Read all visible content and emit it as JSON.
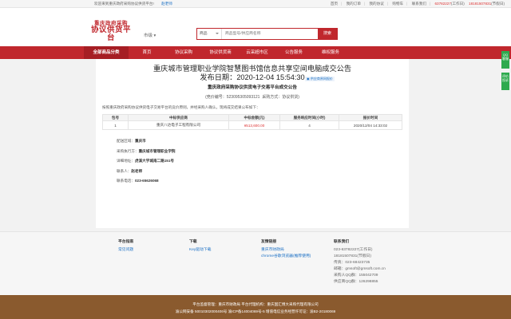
{
  "topbar": {
    "welcome": "欢迎来到重庆政府采购协议供货平台!",
    "user": "赵老师",
    "links": [
      "首页",
      "我的订单",
      "我的协议",
      "购物车",
      "联系我们"
    ],
    "phone1": "63782227",
    "phone1_note": "(工作日)",
    "phone2": "18181507831",
    "phone2_note": "(节假日)"
  },
  "header": {
    "logo_line1": "重庆政府采购",
    "logo_line2": "协议供货平台",
    "region": "市级",
    "search_category": "商品",
    "search_placeholder": "商品型号/供应商名称",
    "search_button": "搜索"
  },
  "nav": {
    "items": [
      "全部商品分类",
      "首页",
      "协议采购",
      "协议供货商",
      "云采超市区",
      "公告服务",
      "维权服务"
    ]
  },
  "side": {
    "tabs": [
      "QQ客服",
      "评价投诉"
    ]
  },
  "notice": {
    "title": "重庆城市管理职业学院智慧图书馆信息共享空间电脑成交公告",
    "date_label": "发布日期：",
    "date": "2020-12-04 15:54:30",
    "pdf_link": "供应商原网报价",
    "subtitle": "重庆政府采购协议供货电子交易平台成交公告",
    "meta_project": "(竞价编号：5230953050931​21",
    "meta_type": "采购方式：协议供货)",
    "intro": "按照重庆政府采购协议供货电子交易平台的竞价原则，并经采购人确认，现将成交结果公布如下："
  },
  "table": {
    "headers": [
      "包号",
      "中标供应商",
      "中标金额(元)",
      "服务响应时间(小时)",
      "报价时间"
    ],
    "rows": [
      [
        "1",
        "重庆八达电子工程有限公司",
        "¥513,600.00",
        "4",
        "2020/12/04 14:33:02"
      ]
    ]
  },
  "details": {
    "delivery_label": "配送区域：",
    "delivery": "重庆市",
    "buyer_label": "采购执行方：",
    "buyer": "重庆城市管理职业学院",
    "address_label": "详细地址：",
    "address": "虎溪大学城南二路151号",
    "contact_label": "联系人：",
    "contact": "赵老师",
    "phone_label": "联系电话：",
    "phone": "023-65626068"
  },
  "footer": {
    "col1_title": "平台指南",
    "col1_links": [
      "常见问题"
    ],
    "col2_title": "下载",
    "col2_links": [
      "Key驱动下载"
    ],
    "col3_title": "友情链接",
    "col3_links": [
      "重庆市财政局",
      "chrome谷歌浏览器(推荐使用)"
    ],
    "col4_title": "联系我们",
    "col4_lines": [
      "023-63782227(工作日)",
      "18181507831(节假日)",
      "传真：023-68423735",
      "邮箱：gmsoft@gmsoft.com.cn",
      "采购人QQ群：155042709",
      "供应商QQ群：126298855"
    ]
  },
  "bottom": {
    "line1": "平台监督管理：重庆市财政局    平台代理机构：重庆国汇博大采购代理有限公司",
    "line2": "渝公网安备 50010302000406号   渝ICP备14004069号-5   增值电信业务经营许可证：渝B2-20180069"
  }
}
